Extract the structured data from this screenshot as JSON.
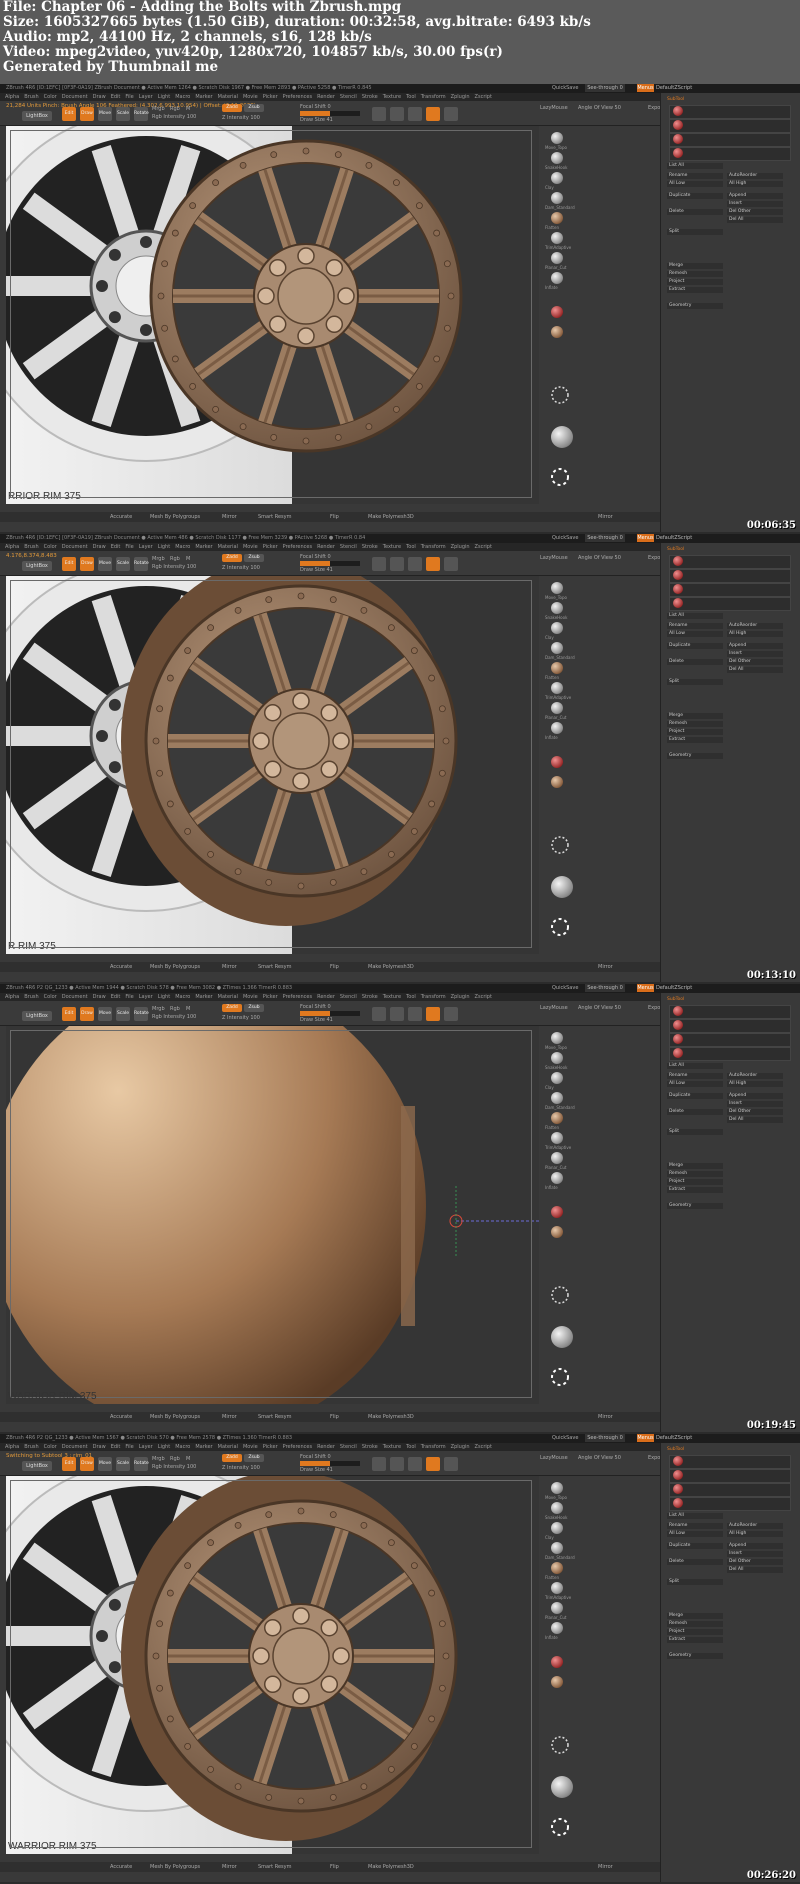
{
  "info": {
    "file": "File: Chapter 06 - Adding the Bolts with Zbrush.mpg",
    "size": "Size: 1605327665 bytes (1.50 GiB), duration: 00:32:58, avg.bitrate: 6493 kb/s",
    "audio": "Audio: mp2, 44100 Hz, 2 channels, s16, 128 kb/s",
    "video": "Video: mpeg2video, yuv420p, 1280x720, 104857 kb/s, 30.00 fps(r)",
    "generated": "Generated by Thumbnail me"
  },
  "colors": {
    "accent": "#e0791f",
    "rim": "#7b6450",
    "panel": "#393939"
  },
  "frames": [
    {
      "timestamp": "00:06:35",
      "titlebar": "ZBrush 4R6 [ID:1EFC] [0F3F-0A19]   ZBrush Document   ● Active Mem 1264 ● Scratch Disk 1967 ● Free Mem 2893 ● PActive 5258 ● TimerR 0.845",
      "status": "21,284 Units    Pinch: Brush Angle 106 Feathered: (4.302,6.993,10.954) | Offset: (6,11,2068)",
      "menu": [
        "Alpha",
        "Brush",
        "Color",
        "Document",
        "Draw",
        "Edit",
        "File",
        "Layer",
        "Light",
        "Macro",
        "Marker",
        "Material",
        "Movie",
        "Picker",
        "Preferences",
        "Render",
        "Stencil",
        "Stroke",
        "Texture",
        "Tool",
        "Transform",
        "Zplugin",
        "Zscript"
      ],
      "reference_caption": "RRIOR RIM 375",
      "bottom": [
        "Accurate",
        "Mesh By Polygroups",
        "Mirror",
        "Smart Resym",
        "Flip",
        "Make Polymesh3D",
        "Mirror"
      ]
    },
    {
      "timestamp": "00:13:10",
      "titlebar": "ZBrush 4R6 [ID:1EFC] [0F3F-0A19]   ZBrush Document   ● Active Mem 486 ● Scratch Disk 1177 ● Free Mem 3239 ● PActive 5268 ● TimerR 0.84",
      "status": "4.176,8.374,8.483",
      "menu": [
        "Alpha",
        "Brush",
        "Color",
        "Document",
        "Draw",
        "Edit",
        "File",
        "Layer",
        "Light",
        "Macro",
        "Marker",
        "Material",
        "Movie",
        "Picker",
        "Preferences",
        "Render",
        "Stencil",
        "Stroke",
        "Texture",
        "Tool",
        "Transform",
        "Zplugin",
        "Zscript"
      ],
      "reference_caption": "R RIM 375",
      "bottom": [
        "Accurate",
        "Mesh By Polygroups",
        "Mirror",
        "Smart Resym",
        "Flip",
        "Make Polymesh3D",
        "Mirror"
      ]
    },
    {
      "timestamp": "00:19:45",
      "titlebar": "ZBrush 4R6 P2   QG_1233   ● Active Mem 1944 ● Scratch Disk 578 ● Free Mem 3082 ● ZTimes 1.366 TimerR 0.883",
      "status": "",
      "menu": [
        "Alpha",
        "Brush",
        "Color",
        "Document",
        "Draw",
        "Edit",
        "File",
        "Layer",
        "Light",
        "Macro",
        "Marker",
        "Material",
        "Movie",
        "Picker",
        "Preferences",
        "Render",
        "Stencil",
        "Stroke",
        "Texture",
        "Tool",
        "Transform",
        "Zplugin",
        "Zscript"
      ],
      "reference_caption": "WARRIOR RIM 375",
      "bottom": [
        "Accurate",
        "Mesh By Polygroups",
        "Mirror",
        "Smart Resym",
        "Flip",
        "Make Polymesh3D",
        "Mirror"
      ]
    },
    {
      "timestamp": "00:26:20",
      "titlebar": "ZBrush 4R6 P2   QG_1233   ● Active Mem 1567 ● Scratch Disk 570 ● Free Mem 2578 ● ZTimes 1.360 TimerR 0.883",
      "status": "Switching to Subtool 3 : rim_01",
      "menu": [
        "Alpha",
        "Brush",
        "Color",
        "Document",
        "Draw",
        "Edit",
        "File",
        "Layer",
        "Light",
        "Macro",
        "Marker",
        "Material",
        "Movie",
        "Picker",
        "Preferences",
        "Render",
        "Stencil",
        "Stroke",
        "Texture",
        "Tool",
        "Transform",
        "Zplugin",
        "Zscript"
      ],
      "reference_caption": "WARRIOR RIM 375",
      "bottom": [
        "Accurate",
        "Mesh By Polygroups",
        "Mirror",
        "Smart Resym",
        "Flip",
        "Make Polymesh3D",
        "Mirror"
      ]
    }
  ],
  "toolbar": {
    "lightbox": "LightBox",
    "quicksave": "QuickSave",
    "seethrough": "See-through 0",
    "menus": "Menus",
    "defaultzscript": "DefaultZScript",
    "edit": "Edit",
    "draw": "Draw",
    "move": "Move",
    "scale": "Scale",
    "rotate": "Rotate",
    "mrgb": "Mrgb",
    "rgb": "Rgb",
    "m": "M",
    "rgb_intensity": "Rgb Intensity 100",
    "zadd": "Zadd",
    "zsub": "Zsub",
    "z_intensity": "Z Intensity 100",
    "focal_shift": "Focal Shift 0",
    "draw_size": "Draw Size 41",
    "lazymouse": "LazyMouse",
    "angle_of_view": "Angle Of View 50",
    "export": "Export"
  },
  "tray": {
    "subtool": "SubTool",
    "list": "List All",
    "rename": "Rename",
    "autoreorder": "AutoReorder",
    "all_low": "All Low",
    "all_high": "All High",
    "duplicate": "Duplicate",
    "append": "Append",
    "insert": "Insert",
    "delete": "Delete",
    "del_other": "Del Other",
    "del_all": "Del All",
    "split": "Split",
    "merge": "Merge",
    "remesh": "Remesh",
    "project": "Project",
    "extract": "Extract",
    "geometry": "Geometry"
  },
  "shelf": [
    "Move_Topo",
    "SnakeHook",
    "Clay",
    "Dam_Standard",
    "Flatten",
    "TrimAdaptive",
    "Planar_Cut",
    "Inflate"
  ]
}
